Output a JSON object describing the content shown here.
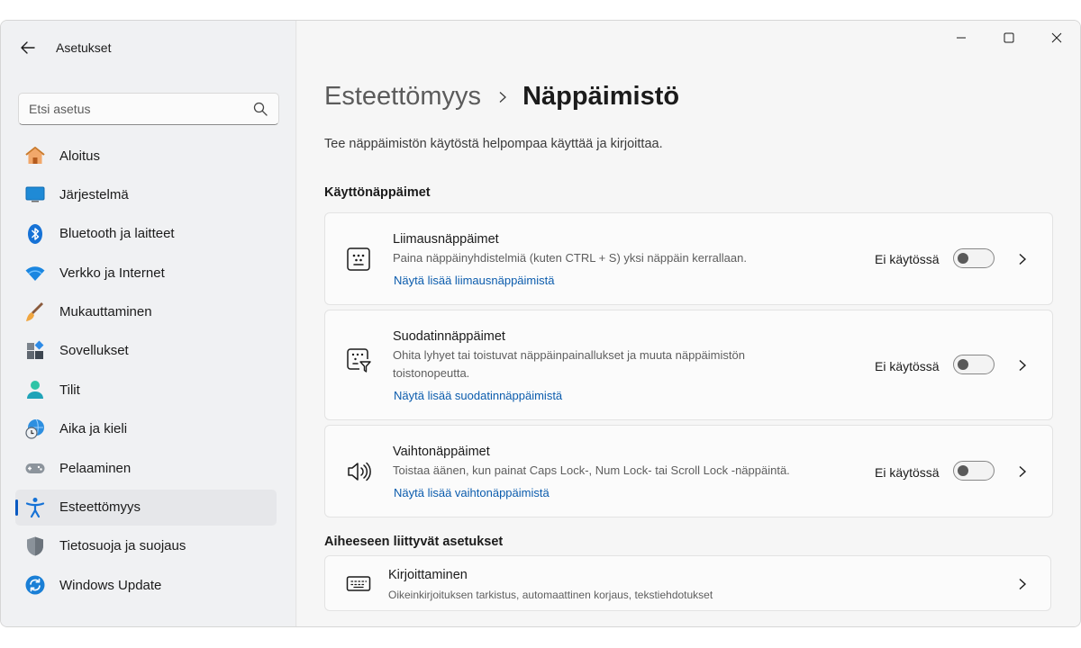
{
  "app": {
    "title": "Asetukset"
  },
  "search": {
    "placeholder": "Etsi asetus"
  },
  "sidebar": {
    "items": [
      {
        "label": "Aloitus",
        "icon": "home-icon"
      },
      {
        "label": "Järjestelmä",
        "icon": "system-icon"
      },
      {
        "label": "Bluetooth ja laitteet",
        "icon": "bluetooth-icon"
      },
      {
        "label": "Verkko ja Internet",
        "icon": "wifi-icon"
      },
      {
        "label": "Mukauttaminen",
        "icon": "brush-icon"
      },
      {
        "label": "Sovellukset",
        "icon": "apps-icon"
      },
      {
        "label": "Tilit",
        "icon": "account-icon"
      },
      {
        "label": "Aika ja kieli",
        "icon": "clock-globe-icon"
      },
      {
        "label": "Pelaaminen",
        "icon": "gamepad-icon"
      },
      {
        "label": "Esteettömyys",
        "icon": "accessibility-icon",
        "active": true
      },
      {
        "label": "Tietosuoja ja suojaus",
        "icon": "shield-icon"
      },
      {
        "label": "Windows Update",
        "icon": "update-icon"
      }
    ]
  },
  "header": {
    "parent": "Esteettömyys",
    "current": "Näppäimistö",
    "description": "Tee näppäimistön käytöstä helpompaa käyttää ja kirjoittaa."
  },
  "sections": {
    "keys_title": "Käyttönäppäimet",
    "related_title": "Aiheeseen liittyvät asetukset"
  },
  "cards": {
    "sticky": {
      "title": "Liimausnäppäimet",
      "desc": "Paina näppäinyhdistelmiä (kuten CTRL + S) yksi näppäin kerrallaan.",
      "link": "Näytä lisää liimausnäppäimistä",
      "state": "Ei käytössä",
      "enabled": false
    },
    "filter": {
      "title": "Suodatinnäppäimet",
      "desc": "Ohita lyhyet tai toistuvat näppäinpainallukset ja muuta näppäimistön toistonopeutta.",
      "link": "Näytä lisää suodatinnäppäimistä",
      "state": "Ei käytössä",
      "enabled": false
    },
    "toggle": {
      "title": "Vaihtonäppäimet",
      "desc": "Toistaa äänen, kun painat Caps Lock-, Num Lock- tai Scroll Lock -näppäintä.",
      "link": "Näytä lisää vaihtonäppäimistä",
      "state": "Ei käytössä",
      "enabled": false
    },
    "typing": {
      "title": "Kirjoittaminen",
      "desc": "Oikeinkirjoituksen tarkistus, automaattinen korjaus, tekstiehdotukset"
    }
  },
  "colors": {
    "accent": "#0a5ac2",
    "link": "#0b5cad"
  }
}
